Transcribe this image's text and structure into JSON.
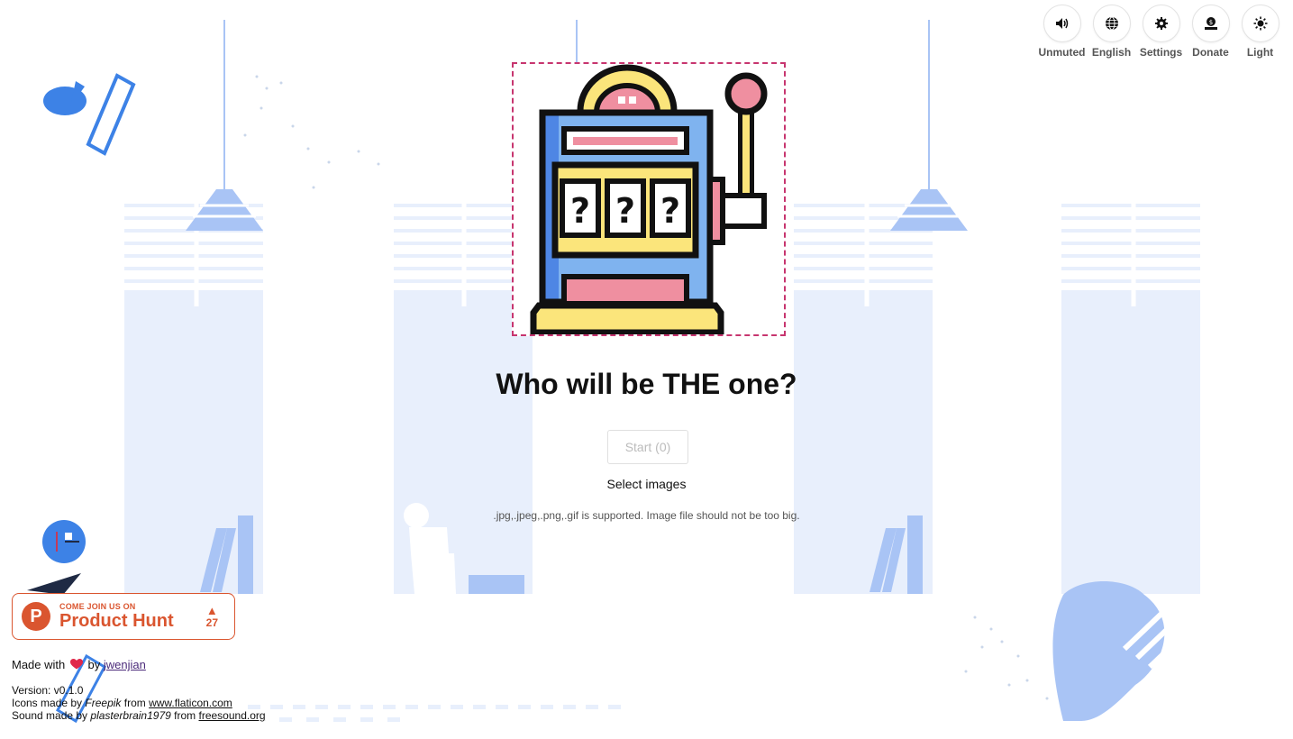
{
  "toolbar": {
    "items": [
      {
        "label": "Unmuted",
        "icon": "speaker-icon"
      },
      {
        "label": "English",
        "icon": "globe-icon"
      },
      {
        "label": "Settings",
        "icon": "gear-icon"
      },
      {
        "label": "Donate",
        "icon": "donate-icon"
      },
      {
        "label": "Light",
        "icon": "sun-icon"
      }
    ]
  },
  "main": {
    "image_icon": "slot-machine-icon",
    "title": "Who will be THE one?",
    "start_label": "Start (0)",
    "select_label": "Select images",
    "hint": ".jpg,.jpeg,.png,.gif is supported. Image file should not be too big."
  },
  "product_hunt": {
    "small": "COME JOIN US ON",
    "big": "Product Hunt",
    "logo_letter": "P",
    "arrow": "▲",
    "votes": "27"
  },
  "footer": {
    "made_prefix": "Made with",
    "made_by": "by",
    "author": "jwenjian",
    "version": "Version: v0.1.0",
    "icons_prefix": "Icons made by",
    "icons_author": "Freepik",
    "icons_from": "from",
    "icons_site": "www.flaticon.com",
    "sound_prefix": "Sound made by",
    "sound_author": "plasterbrain1979",
    "sound_from": "from",
    "sound_site": "freesound.org"
  },
  "colors": {
    "accent": "#da552f",
    "dashed_border": "#c7356f",
    "decor_blue": "#a9c4f5",
    "decor_light": "#e8effc"
  }
}
